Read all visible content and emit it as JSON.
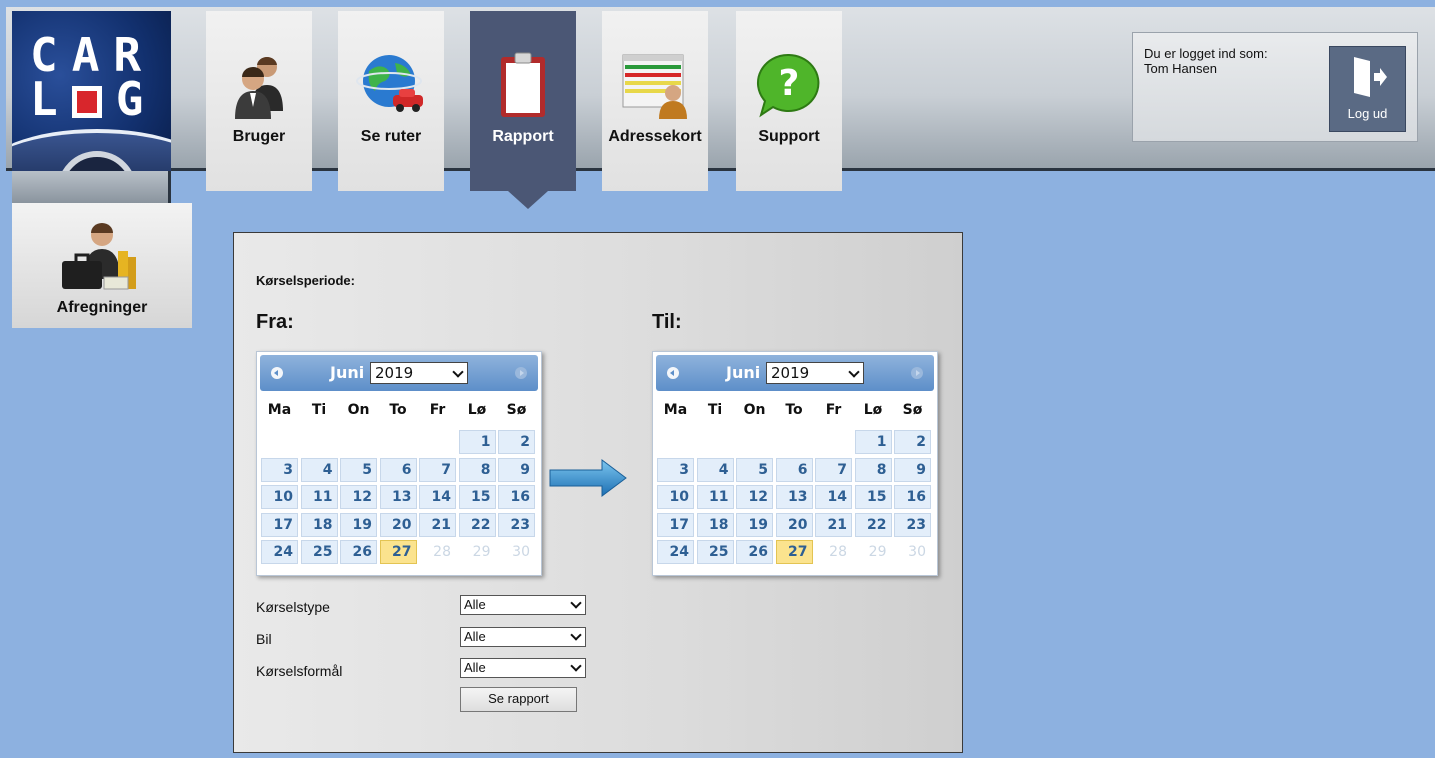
{
  "logo": {
    "line1": "CAR",
    "line2_left": "L",
    "line2_right": "G"
  },
  "nav": {
    "tabs": [
      {
        "label": "Bruger",
        "icon": "users-icon",
        "active": false
      },
      {
        "label": "Se ruter",
        "icon": "globe-car-icon",
        "active": false
      },
      {
        "label": "Rapport",
        "icon": "clipboard-icon",
        "active": true
      },
      {
        "label": "Adressekort",
        "icon": "address-card-icon",
        "active": false
      },
      {
        "label": "Support",
        "icon": "question-bubble-icon",
        "active": false
      }
    ]
  },
  "login": {
    "line1": "Du er logget ind som:",
    "user": "Tom Hansen",
    "logout_label": "Log ud"
  },
  "side": {
    "afregninger_label": "Afregninger"
  },
  "report": {
    "period_title": "Kørselsperiode:",
    "from_heading": "Fra:",
    "to_heading": "Til:",
    "calendar_from": {
      "month": "Juni",
      "year": "2019",
      "weekdays": [
        "Ma",
        "Ti",
        "On",
        "To",
        "Fr",
        "Lø",
        "Sø"
      ],
      "selected": "27"
    },
    "calendar_to": {
      "month": "Juni",
      "year": "2019",
      "weekdays": [
        "Ma",
        "Ti",
        "On",
        "To",
        "Fr",
        "Lø",
        "Sø"
      ],
      "selected": "27"
    },
    "days": {
      "rows": [
        [
          "",
          "",
          "",
          "",
          "",
          "1",
          "2"
        ],
        [
          "3",
          "4",
          "5",
          "6",
          "7",
          "8",
          "9"
        ],
        [
          "10",
          "11",
          "12",
          "13",
          "14",
          "15",
          "16"
        ],
        [
          "17",
          "18",
          "19",
          "20",
          "21",
          "22",
          "23"
        ],
        [
          "24",
          "25",
          "26",
          "27",
          "28",
          "29",
          "30"
        ]
      ],
      "disabled": [
        "28",
        "29",
        "30"
      ]
    },
    "filters": [
      {
        "label": "Kørselstype",
        "value": "Alle"
      },
      {
        "label": "Bil",
        "value": "Alle"
      },
      {
        "label": "Kørselsformål",
        "value": "Alle"
      }
    ],
    "submit_label": "Se rapport"
  },
  "colors": {
    "background": "#8db1e0",
    "active_tab": "#4b5775",
    "calendar_header": "#5d8fc9",
    "today_highlight": "#fbe38e",
    "day_text": "#2e5f93"
  }
}
